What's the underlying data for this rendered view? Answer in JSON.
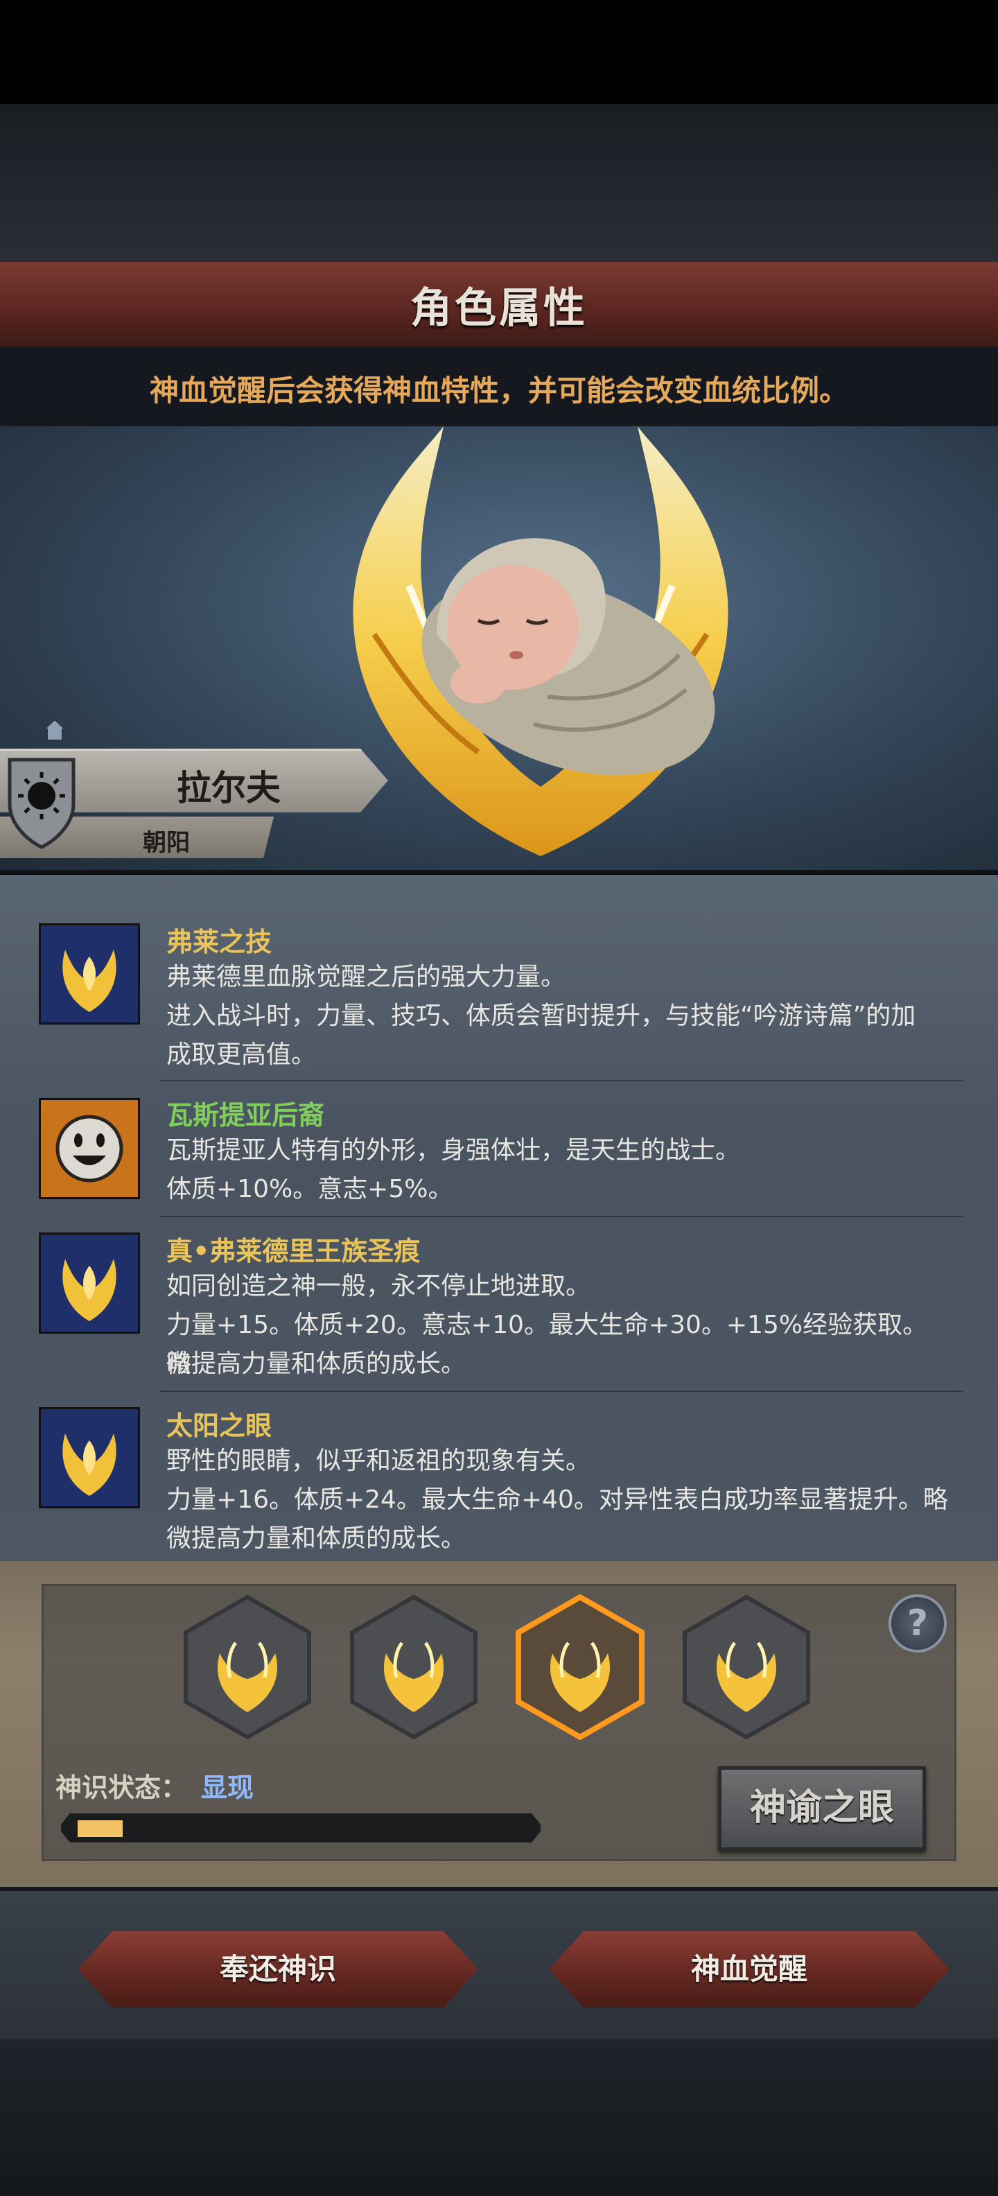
{
  "header": {
    "title": "角色属性",
    "subtitle": "神血觉醒后会获得神血特性，并可能会改变血统比例。"
  },
  "character": {
    "name": "拉尔夫",
    "title": "朝阳"
  },
  "traits": [
    {
      "name": "弗莱之技",
      "name_color": "#e8c45a",
      "icon": "golden-crest-icon",
      "lines": [
        "弗莱德里血脉觉醒之后的强大力量。",
        "进入战斗时，力量、技巧、体质会暂时提升，与技能“吟游诗篇”的加",
        "成取更高值。"
      ]
    },
    {
      "name": "瓦斯提亚后裔",
      "name_color": "#7fcf5a",
      "icon": "smiling-face-icon",
      "lines": [
        "瓦斯提亚人特有的外形，身强体壮，是天生的战士。",
        "体质+10%。意志+5%。"
      ]
    },
    {
      "name": "真•弗莱德里王族圣痕",
      "name_color": "#e8c45a",
      "icon": "golden-crest-icon",
      "lines": [
        "如同创造之神一般，永不停止地进取。",
        "力量+15。体质+20。意志+10。最大生命+30。+15%经验获取。略",
        "微提高力量和体质的成长。"
      ]
    },
    {
      "name": "太阳之眼",
      "name_color": "#e8c45a",
      "icon": "golden-crest-icon",
      "lines": [
        "野性的眼睛，似乎和返祖的现象有关。",
        "力量+16。体质+24。最大生命+40。对异性表白成功率显著提升。略",
        "微提高力量和体质的成长。"
      ]
    }
  ],
  "divine_slots": {
    "selected_index": 2,
    "help_symbol": "?"
  },
  "status": {
    "label": "神识状态：",
    "value": "显现",
    "progress": 0.1
  },
  "buttons": {
    "oracle_eye": "神谕之眼",
    "return_consciousness": "奉还神识",
    "blood_awaken": "神血觉醒"
  },
  "colors": {
    "accent_orange": "#e6a85a",
    "status_blue": "#8fb8ff",
    "banner_red": "#642822"
  }
}
